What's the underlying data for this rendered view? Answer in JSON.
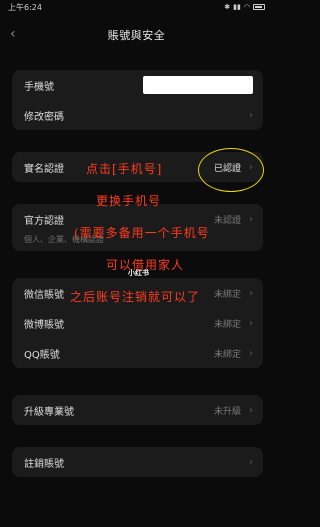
{
  "status": {
    "time": "上午6:24",
    "icons": [
      "bluetooth-icon",
      "signal-icon",
      "wifi-icon",
      "battery-icon"
    ]
  },
  "nav": {
    "title": "賬號與安全",
    "back_icon": "back-chevron-icon"
  },
  "groups": {
    "account": {
      "phone_label": "手機號",
      "password_label": "修改密碼"
    },
    "realname": {
      "label": "實名認證",
      "value": "已認證"
    },
    "official": {
      "label": "官方認證",
      "value": "未認證",
      "subtext": "個人、企業、機構認證"
    },
    "bindings": {
      "wechat_label": "微信賬號",
      "wechat_value": "未綁定",
      "weibo_label": "微博賬號",
      "weibo_value": "未綁定",
      "qq_label": "QQ賬號",
      "qq_value": "未綁定"
    },
    "upgrade": {
      "label": "升級專業號",
      "value": "未升級"
    },
    "cancel": {
      "label": "註銷賬號"
    }
  },
  "overlay": {
    "line1": "点击[手机号]",
    "line2": "更换手机号",
    "line3": "(需要多备用一个手机号",
    "line4": "可以借用家人",
    "line5": "之后账号注销就可以了",
    "watermark": "小红书"
  },
  "colors": {
    "background": "#0b0b0b",
    "card": "#1b1b1b",
    "overlay_text": "#ff3b1f",
    "highlight_circle": "#e8d21a"
  }
}
